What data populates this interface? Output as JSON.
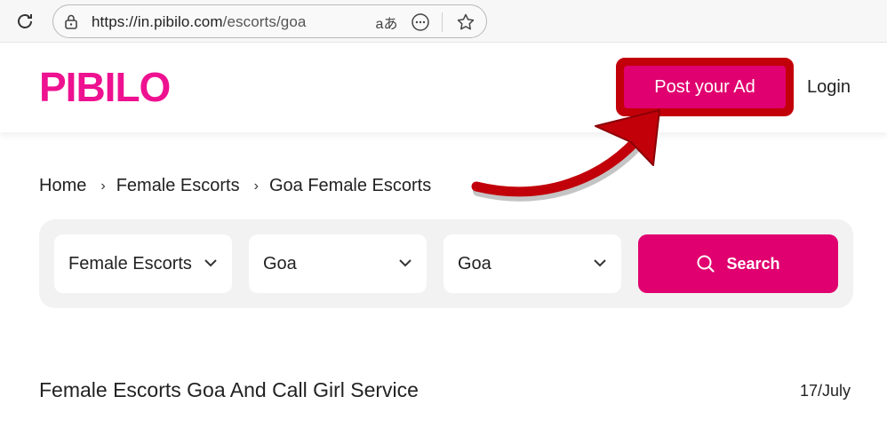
{
  "browser": {
    "url_host": "https://in.pibilo.com",
    "url_path": "/escorts/goa",
    "translate_glyph": "aあ"
  },
  "header": {
    "logo": "PIBILO",
    "post_ad_label": "Post your Ad",
    "login_label": "Login"
  },
  "breadcrumb": {
    "items": [
      "Home",
      "Female Escorts",
      "Goa Female Escorts"
    ],
    "separator": "›"
  },
  "search": {
    "category": "Female Escorts",
    "state": "Goa",
    "city": "Goa",
    "button_label": "Search"
  },
  "listing": {
    "title": "Female Escorts Goa And Call Girl Service",
    "date": "17/July"
  },
  "colors": {
    "brand": "#ee1190",
    "button": "#e0006f",
    "highlight": "#c2000a"
  },
  "icons": [
    "reload-icon",
    "lock-icon",
    "translate-icon",
    "more-icon",
    "star-icon",
    "chevron-down-icon",
    "search-icon",
    "arrow-annotation"
  ]
}
